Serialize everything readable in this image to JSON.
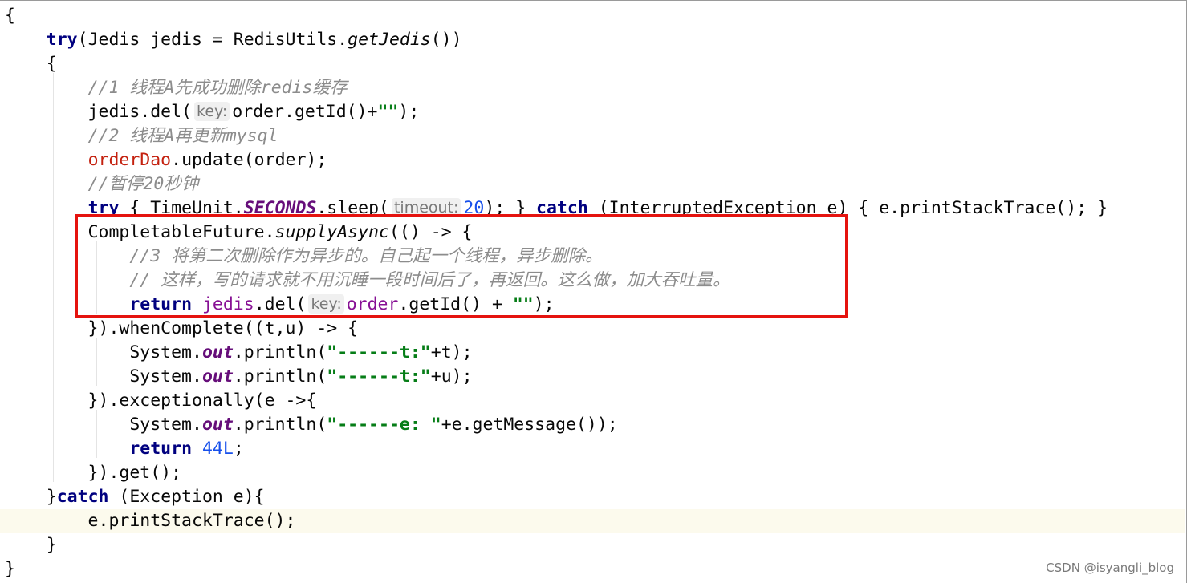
{
  "watermark": "CSDN @isyangli_blog",
  "lines": [
    [
      {
        "t": "{",
        "c": ""
      }
    ],
    [
      {
        "t": "    ",
        "c": ""
      },
      {
        "t": "try",
        "c": "kw"
      },
      {
        "t": "(Jedis jedis = RedisUtils.",
        "c": ""
      },
      {
        "t": "getJedis",
        "c": "italic"
      },
      {
        "t": "())",
        "c": ""
      }
    ],
    [
      {
        "t": "    {",
        "c": ""
      }
    ],
    [
      {
        "t": "        ",
        "c": ""
      },
      {
        "t": "//1 线程A先成功删除redis缓存",
        "c": "comment"
      }
    ],
    [
      {
        "t": "        jedis.del(",
        "c": ""
      },
      {
        "t": "key:",
        "c": "hint"
      },
      {
        "t": "order.getId()+",
        "c": ""
      },
      {
        "t": "\"\"",
        "c": "string"
      },
      {
        "t": ");",
        "c": ""
      }
    ],
    [
      {
        "t": "        ",
        "c": ""
      },
      {
        "t": "//2 线程A再更新mysql",
        "c": "comment"
      }
    ],
    [
      {
        "t": "        ",
        "c": ""
      },
      {
        "t": "orderDao",
        "c": "field"
      },
      {
        "t": ".update(order);",
        "c": ""
      }
    ],
    [
      {
        "t": "        ",
        "c": ""
      },
      {
        "t": "//暂停20秒钟",
        "c": "comment"
      }
    ],
    [
      {
        "t": "        ",
        "c": ""
      },
      {
        "t": "try",
        "c": "kw"
      },
      {
        "t": " { TimeUnit.",
        "c": ""
      },
      {
        "t": "SECONDS",
        "c": "static"
      },
      {
        "t": ".sleep(",
        "c": ""
      },
      {
        "t": "timeout:",
        "c": "hint"
      },
      {
        "t": "20",
        "c": "num"
      },
      {
        "t": "); } ",
        "c": ""
      },
      {
        "t": "catch",
        "c": "kw"
      },
      {
        "t": " (InterruptedException e) { e.printStackTrace(); }",
        "c": ""
      }
    ],
    [
      {
        "t": "        CompletableFuture.",
        "c": ""
      },
      {
        "t": "supplyAsync",
        "c": "italic"
      },
      {
        "t": "(() -> {",
        "c": ""
      }
    ],
    [
      {
        "t": "            ",
        "c": ""
      },
      {
        "t": "//3 将第二次删除作为异步的。自己起一个线程，异步删除。",
        "c": "comment"
      }
    ],
    [
      {
        "t": "            ",
        "c": ""
      },
      {
        "t": "// 这样，写的请求就不用沉睡一段时间后了，再返回。这么做，加大吞吐量。",
        "c": "comment"
      }
    ],
    [
      {
        "t": "            ",
        "c": ""
      },
      {
        "t": "return",
        "c": "kw"
      },
      {
        "t": " ",
        "c": ""
      },
      {
        "t": "jedis",
        "c": "local"
      },
      {
        "t": ".del(",
        "c": ""
      },
      {
        "t": "key:",
        "c": "hint"
      },
      {
        "t": "order",
        "c": "local"
      },
      {
        "t": ".getId() + ",
        "c": ""
      },
      {
        "t": "\"\"",
        "c": "string"
      },
      {
        "t": ");",
        "c": ""
      }
    ],
    [
      {
        "t": "        }).whenComplete((t,u) -> {",
        "c": ""
      }
    ],
    [
      {
        "t": "            System.",
        "c": ""
      },
      {
        "t": "out",
        "c": "static"
      },
      {
        "t": ".println(",
        "c": ""
      },
      {
        "t": "\"------t:\"",
        "c": "str-bold"
      },
      {
        "t": "+t);",
        "c": ""
      }
    ],
    [
      {
        "t": "            System.",
        "c": ""
      },
      {
        "t": "out",
        "c": "static"
      },
      {
        "t": ".println(",
        "c": ""
      },
      {
        "t": "\"------t:\"",
        "c": "str-bold"
      },
      {
        "t": "+u);",
        "c": ""
      }
    ],
    [
      {
        "t": "        }).exceptionally(e ->{",
        "c": ""
      }
    ],
    [
      {
        "t": "            System.",
        "c": ""
      },
      {
        "t": "out",
        "c": "static"
      },
      {
        "t": ".println(",
        "c": ""
      },
      {
        "t": "\"------e: \"",
        "c": "str-bold"
      },
      {
        "t": "+e.getMessage());",
        "c": ""
      }
    ],
    [
      {
        "t": "            ",
        "c": ""
      },
      {
        "t": "return",
        "c": "kw"
      },
      {
        "t": " ",
        "c": ""
      },
      {
        "t": "44L",
        "c": "num"
      },
      {
        "t": ";",
        "c": ""
      }
    ],
    [
      {
        "t": "        }).get();",
        "c": ""
      }
    ],
    [
      {
        "t": "    }",
        "c": ""
      },
      {
        "t": "catch",
        "c": "kw"
      },
      {
        "t": " (Exception e){",
        "c": ""
      }
    ],
    [
      {
        "t": "        e.printStackTrace();",
        "c": ""
      }
    ],
    [
      {
        "t": "    }",
        "c": ""
      }
    ],
    [
      {
        "t": "}",
        "c": ""
      }
    ]
  ],
  "current_line_index": 21,
  "highlight_box": {
    "color": "#e5130f",
    "from_line": 9,
    "to_line": 12
  }
}
